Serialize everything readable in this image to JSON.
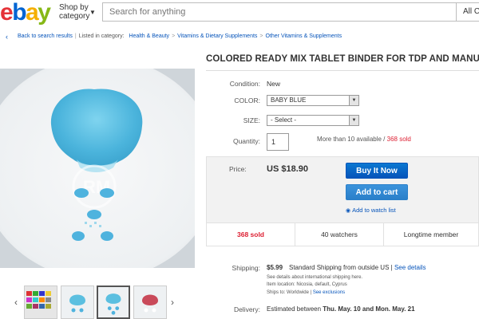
{
  "header": {
    "logo_letters": [
      "e",
      "b",
      "a",
      "y"
    ],
    "shop_by_category": [
      "Shop by",
      "category"
    ],
    "search_placeholder": "Search for anything",
    "all_categories": "All Ca"
  },
  "breadcrumb": {
    "back_link": "Back to search results",
    "listed_in": "Listed in category:",
    "categories": [
      "Health & Beauty",
      "Vitamins & Dietary Supplements",
      "Other Vitamins & Supplements"
    ]
  },
  "item": {
    "title": "COLORED READY MIX TABLET BINDER FOR TDP AND MANUAL T",
    "condition_label": "Condition:",
    "condition_value": "New",
    "color_label": "COLOR:",
    "color_value": "BABY BLUE",
    "size_label": "SIZE:",
    "size_value": "- Select -",
    "quantity_label": "Quantity:",
    "quantity_value": "1",
    "availability": "More than 10 available /",
    "sold_count": "368 sold",
    "watermark": "RM"
  },
  "purchase": {
    "price_label": "Price:",
    "price_value": "US $18.90",
    "buy_now": "Buy It Now",
    "add_to_cart": "Add to cart",
    "watch_list": "Add to watch list",
    "stats": [
      "368 sold",
      "40 watchers",
      "Longtime member"
    ]
  },
  "shipping": {
    "label": "Shipping:",
    "price": "$5.99",
    "description": "Standard Shipping from outside US |",
    "details_link": "See details",
    "intl_details": "See details about international shipping here.",
    "item_location": "Item location:  Nicosia, default, Cyprus",
    "ships_to_label": "Ships to:",
    "ships_to_value": "Worldwide |",
    "exclusions_link": "See exclusions"
  },
  "delivery": {
    "label": "Delivery:",
    "prefix": "Estimated between",
    "dates": "Thu. May. 10 and Mon. May. 21"
  },
  "colors": {
    "link": "#0654ba",
    "sold_red": "#dd1e31",
    "buy_blue": "#0654ba",
    "powder_blue": "#5bbfe0"
  },
  "icons": [
    "chevron-down-icon",
    "back-chevron-icon",
    "eye-icon",
    "thumb-prev-arrow-icon",
    "thumb-next-arrow-icon",
    "thumb-arrow-icon",
    "select-arrow-icon"
  ]
}
